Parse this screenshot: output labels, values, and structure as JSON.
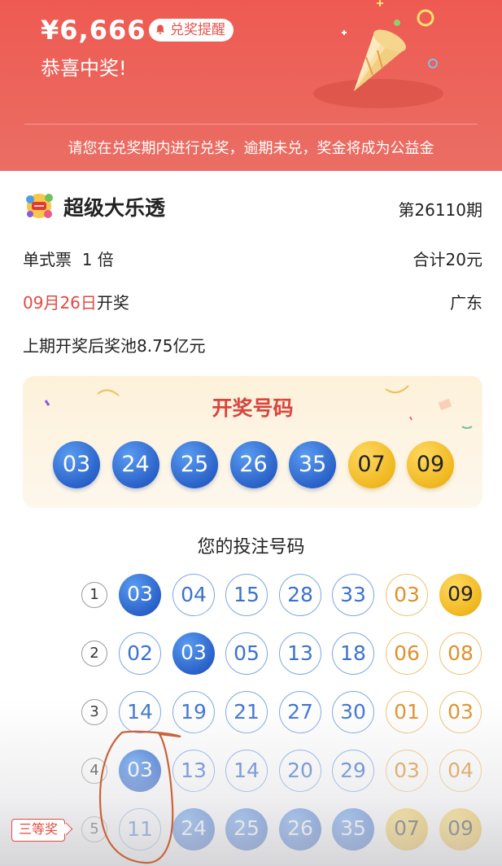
{
  "header": {
    "amount": "¥6,666",
    "badge_label": "兑奖提醒",
    "congrats": "恭喜中奖!",
    "notice": "请您在兑奖期内进行兑奖，逾期未兑，奖金将成为公益金"
  },
  "ticket": {
    "lottery_name": "超级大乐透",
    "issue": "第26110期",
    "ticket_type": "单式票  1 倍",
    "total": "合计20元",
    "draw_date": "09月26日",
    "draw_label": "开奖",
    "region": "广东",
    "pool": "上期开奖后奖池8.75亿元"
  },
  "draw": {
    "title": "开奖号码",
    "front": [
      "03",
      "24",
      "25",
      "26",
      "35"
    ],
    "back": [
      "07",
      "09"
    ]
  },
  "picks_title": "您的投注号码",
  "picks": [
    {
      "index": "1",
      "front": [
        "03",
        "04",
        "15",
        "28",
        "33"
      ],
      "back": [
        "03",
        "09"
      ],
      "front_hit": [
        true,
        false,
        false,
        false,
        false
      ],
      "back_hit": [
        false,
        true
      ]
    },
    {
      "index": "2",
      "front": [
        "02",
        "03",
        "05",
        "13",
        "18"
      ],
      "back": [
        "06",
        "08"
      ],
      "front_hit": [
        false,
        true,
        false,
        false,
        false
      ],
      "back_hit": [
        false,
        false
      ]
    },
    {
      "index": "3",
      "front": [
        "14",
        "19",
        "21",
        "27",
        "30"
      ],
      "back": [
        "01",
        "03"
      ],
      "front_hit": [
        false,
        false,
        false,
        false,
        false
      ],
      "back_hit": [
        false,
        false
      ]
    },
    {
      "index": "4",
      "front": [
        "03",
        "13",
        "14",
        "20",
        "29"
      ],
      "back": [
        "03",
        "04"
      ],
      "front_hit": [
        true,
        false,
        false,
        false,
        false
      ],
      "back_hit": [
        false,
        false
      ]
    },
    {
      "index": "5",
      "front": [
        "11",
        "24",
        "25",
        "26",
        "35"
      ],
      "back": [
        "07",
        "09"
      ],
      "front_hit": [
        false,
        true,
        true,
        true,
        true
      ],
      "back_hit": [
        true,
        true
      ]
    }
  ],
  "prize_tag": "三等奖",
  "colors": {
    "header_red": "#ee5a52",
    "blue_ball": "#2a62c9",
    "gold_ball": "#f0b820",
    "accent_red": "#e24a40"
  }
}
